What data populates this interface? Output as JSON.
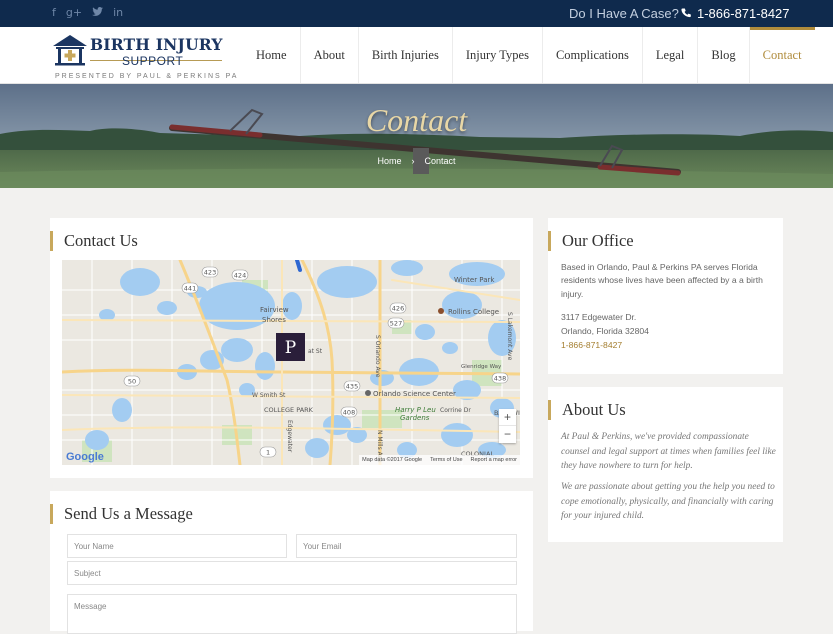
{
  "topbar": {
    "social": [
      "f",
      "g+",
      "t",
      "in"
    ],
    "case_text": "Do I Have A Case?",
    "phone": "1-866-871-8427",
    "phone_icon": "phone-icon"
  },
  "logo": {
    "title": "BIRTH INJURY",
    "subtitle": "SUPPORT",
    "presented": "PRESENTED BY PAUL & PERKINS PA"
  },
  "nav": {
    "items": [
      {
        "label": "Home"
      },
      {
        "label": "About"
      },
      {
        "label": "Birth Injuries"
      },
      {
        "label": "Injury Types"
      },
      {
        "label": "Complications"
      },
      {
        "label": "Legal"
      },
      {
        "label": "Blog"
      },
      {
        "label": "Contact"
      }
    ],
    "active": "Contact"
  },
  "hero": {
    "title": "Contact",
    "breadcrumb": [
      "Home",
      "Contact"
    ],
    "separator": "›"
  },
  "contact": {
    "heading": "Contact Us",
    "map": {
      "labels": {
        "winter_park": "Winter Park",
        "fairview": "Fairview",
        "shores": "Shores",
        "rollins": "Rollins College",
        "college_park": "COLLEGE PARK",
        "science_center": "Orlando Science Center",
        "harry": "Harry P Leu",
        "gardens": "Gardens",
        "orlando_ave": "S Orlando Ave",
        "mills_ave": "N Mills Ave",
        "edgewater": "Edgewater",
        "w_smith": "W Smith St",
        "w_par": "at St",
        "corrine": "Corrine Dr",
        "baldwin": "BALDWI",
        "colonial": "COLONIAL",
        "glenridge": "Glenridge Way",
        "lakemont": "S Lakemont Ave"
      },
      "shields": [
        "424",
        "423",
        "441",
        "426",
        "527",
        "50",
        "408",
        "438",
        "435",
        "1"
      ],
      "attribution": {
        "google": "Google",
        "map_data": "Map data ©2017 Google",
        "terms": "Terms of Use",
        "report": "Report a map error"
      },
      "zoom_in": "+",
      "zoom_out": "−",
      "marker": "P"
    }
  },
  "message": {
    "heading": "Send Us a Message",
    "name_placeholder": "Your Name",
    "email_placeholder": "Your Email",
    "subject_placeholder": "Subject",
    "message_placeholder": "Message"
  },
  "office": {
    "heading": "Our Office",
    "description": "Based in Orlando, Paul & Perkins PA serves Florida residents whose lives have been affected by a a birth injury.",
    "address1": "3117 Edgewater Dr.",
    "address2": "Orlando, Florida 32804",
    "phone": "1-866-871-8427"
  },
  "about": {
    "heading": "About Us",
    "p1": "At Paul & Perkins, we've provided compassionate counsel and legal support at times when families feel like they have nowhere to turn for help.",
    "p2": "We are passionate about getting you the help you need to cope emotionally, physically, and financially with caring for your injured child."
  }
}
